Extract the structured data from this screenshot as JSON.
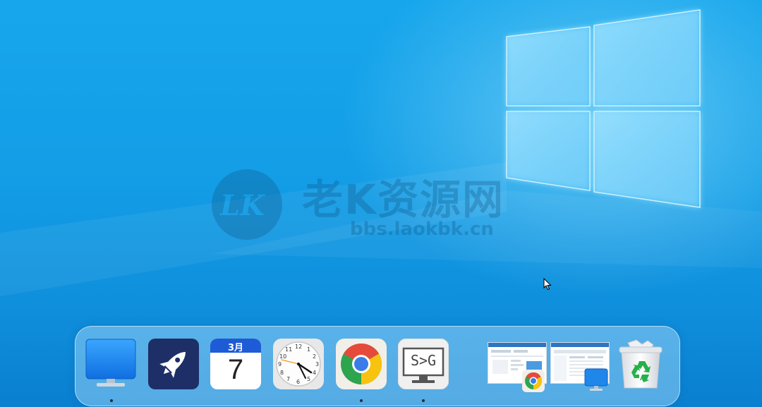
{
  "watermark": {
    "logo_text": "LK",
    "title": "老K资源网",
    "url": "bbs.laokbk.cn"
  },
  "dock": {
    "calendar": {
      "month": "3月",
      "day": "7"
    },
    "svg_tool": {
      "label": "S>G"
    },
    "clock": {
      "numerals": [
        "12",
        "1",
        "2",
        "3",
        "4",
        "5",
        "6",
        "7",
        "8",
        "9",
        "10",
        "11"
      ]
    }
  },
  "colors": {
    "desktop_blue": "#139de6",
    "rocket_bg": "#1d2f66",
    "calendar_header": "#1e5bd6",
    "chrome_red": "#e64a3b",
    "chrome_yellow": "#f8c30f",
    "chrome_green": "#2ea44f",
    "chrome_blue": "#3a7ce8",
    "recycle_green": "#27b04a"
  }
}
